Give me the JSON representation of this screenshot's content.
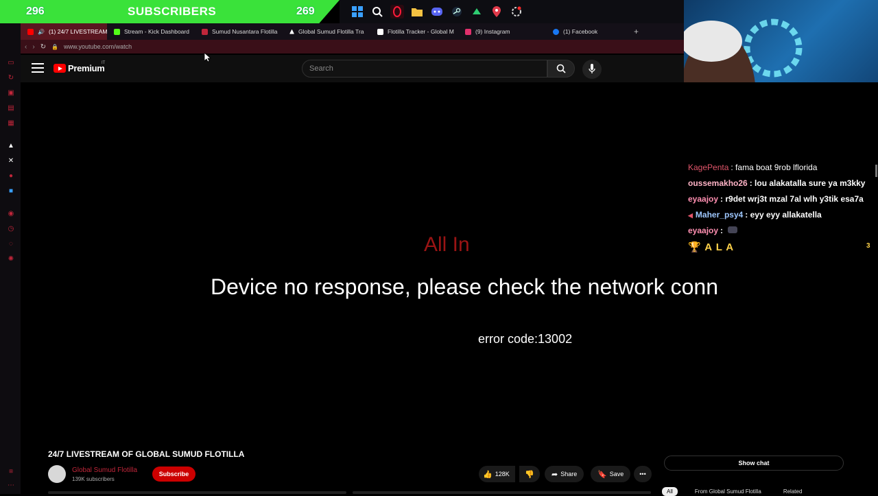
{
  "subscriber_banner": {
    "left_count": "296",
    "title": "SUBSCRIBERS",
    "right_count": "269"
  },
  "taskbar": {
    "icons": [
      "windows-icon",
      "search-icon",
      "opera-icon",
      "folder-icon",
      "discord-icon",
      "steam-icon",
      "app-icon",
      "pin-icon",
      "settings-icon"
    ]
  },
  "tabs": [
    {
      "label": "(1) 24/7 LIVESTREAM",
      "favicon_color": "#ff0000",
      "active": true
    },
    {
      "label": "Stream - Kick Dashboard",
      "favicon_color": "#53fc18"
    },
    {
      "label": "Sumud Nusantara Flotilla",
      "favicon_color": "#c0263a"
    },
    {
      "label": "Global Sumud Flotilla Tra",
      "favicon_color": "#ffffff"
    },
    {
      "label": "Flotilla Tracker - Global M",
      "favicon_color": "#ffffff"
    },
    {
      "label": "(9) Instagram",
      "favicon_color": "#e1306c"
    },
    {
      "label": "(1) Facebook",
      "favicon_color": "#1877f2"
    }
  ],
  "address": {
    "url": "www.youtube.com/watch"
  },
  "youtube": {
    "logo_text": "Premium",
    "logo_superscript": "IT",
    "search_placeholder": "Search"
  },
  "video": {
    "overlay_title": "All In",
    "message": "Device no response, please check the network conn",
    "error": "error code:13002"
  },
  "chat": [
    {
      "user": "KagePenta",
      "text": ": fama boat 9rob lflorida",
      "color": "#e0556a"
    },
    {
      "user": "oussemakho26",
      "text": ": lou alakatalla sure ya m3kky",
      "color": "#ffb3c6"
    },
    {
      "user": "eyaajoy",
      "text": ": r9det wrj3t mzal 7al wlh y3tik esa7a",
      "color": "#ff8fb1"
    },
    {
      "user": "Maher_psy4",
      "text": ": eyy eyy allakatella",
      "color": "#9fc8ff"
    },
    {
      "user": "eyaajoy",
      "text": ":",
      "color": "#ff8fb1"
    },
    {
      "user": "🏆 A L A",
      "text": "",
      "color": "#ffd24a"
    }
  ],
  "chat_counter": "3",
  "below": {
    "title": "24/7 LIVESTREAM OF GLOBAL SUMUD FLOTILLA",
    "channel": "Global Sumud Flotilla",
    "subscribers": "139K subscribers",
    "subscribe_label": "Subscribe",
    "likes": "128K",
    "share_label": "Share",
    "save_label": "Save",
    "show_chat_label": "Show chat",
    "chips": [
      "All",
      "From Global Sumud Flotilla",
      "Related"
    ]
  },
  "colors": {
    "banner_green": "#3ae23a",
    "accent_red": "#c0263a",
    "youtube_red": "#ff0000"
  }
}
